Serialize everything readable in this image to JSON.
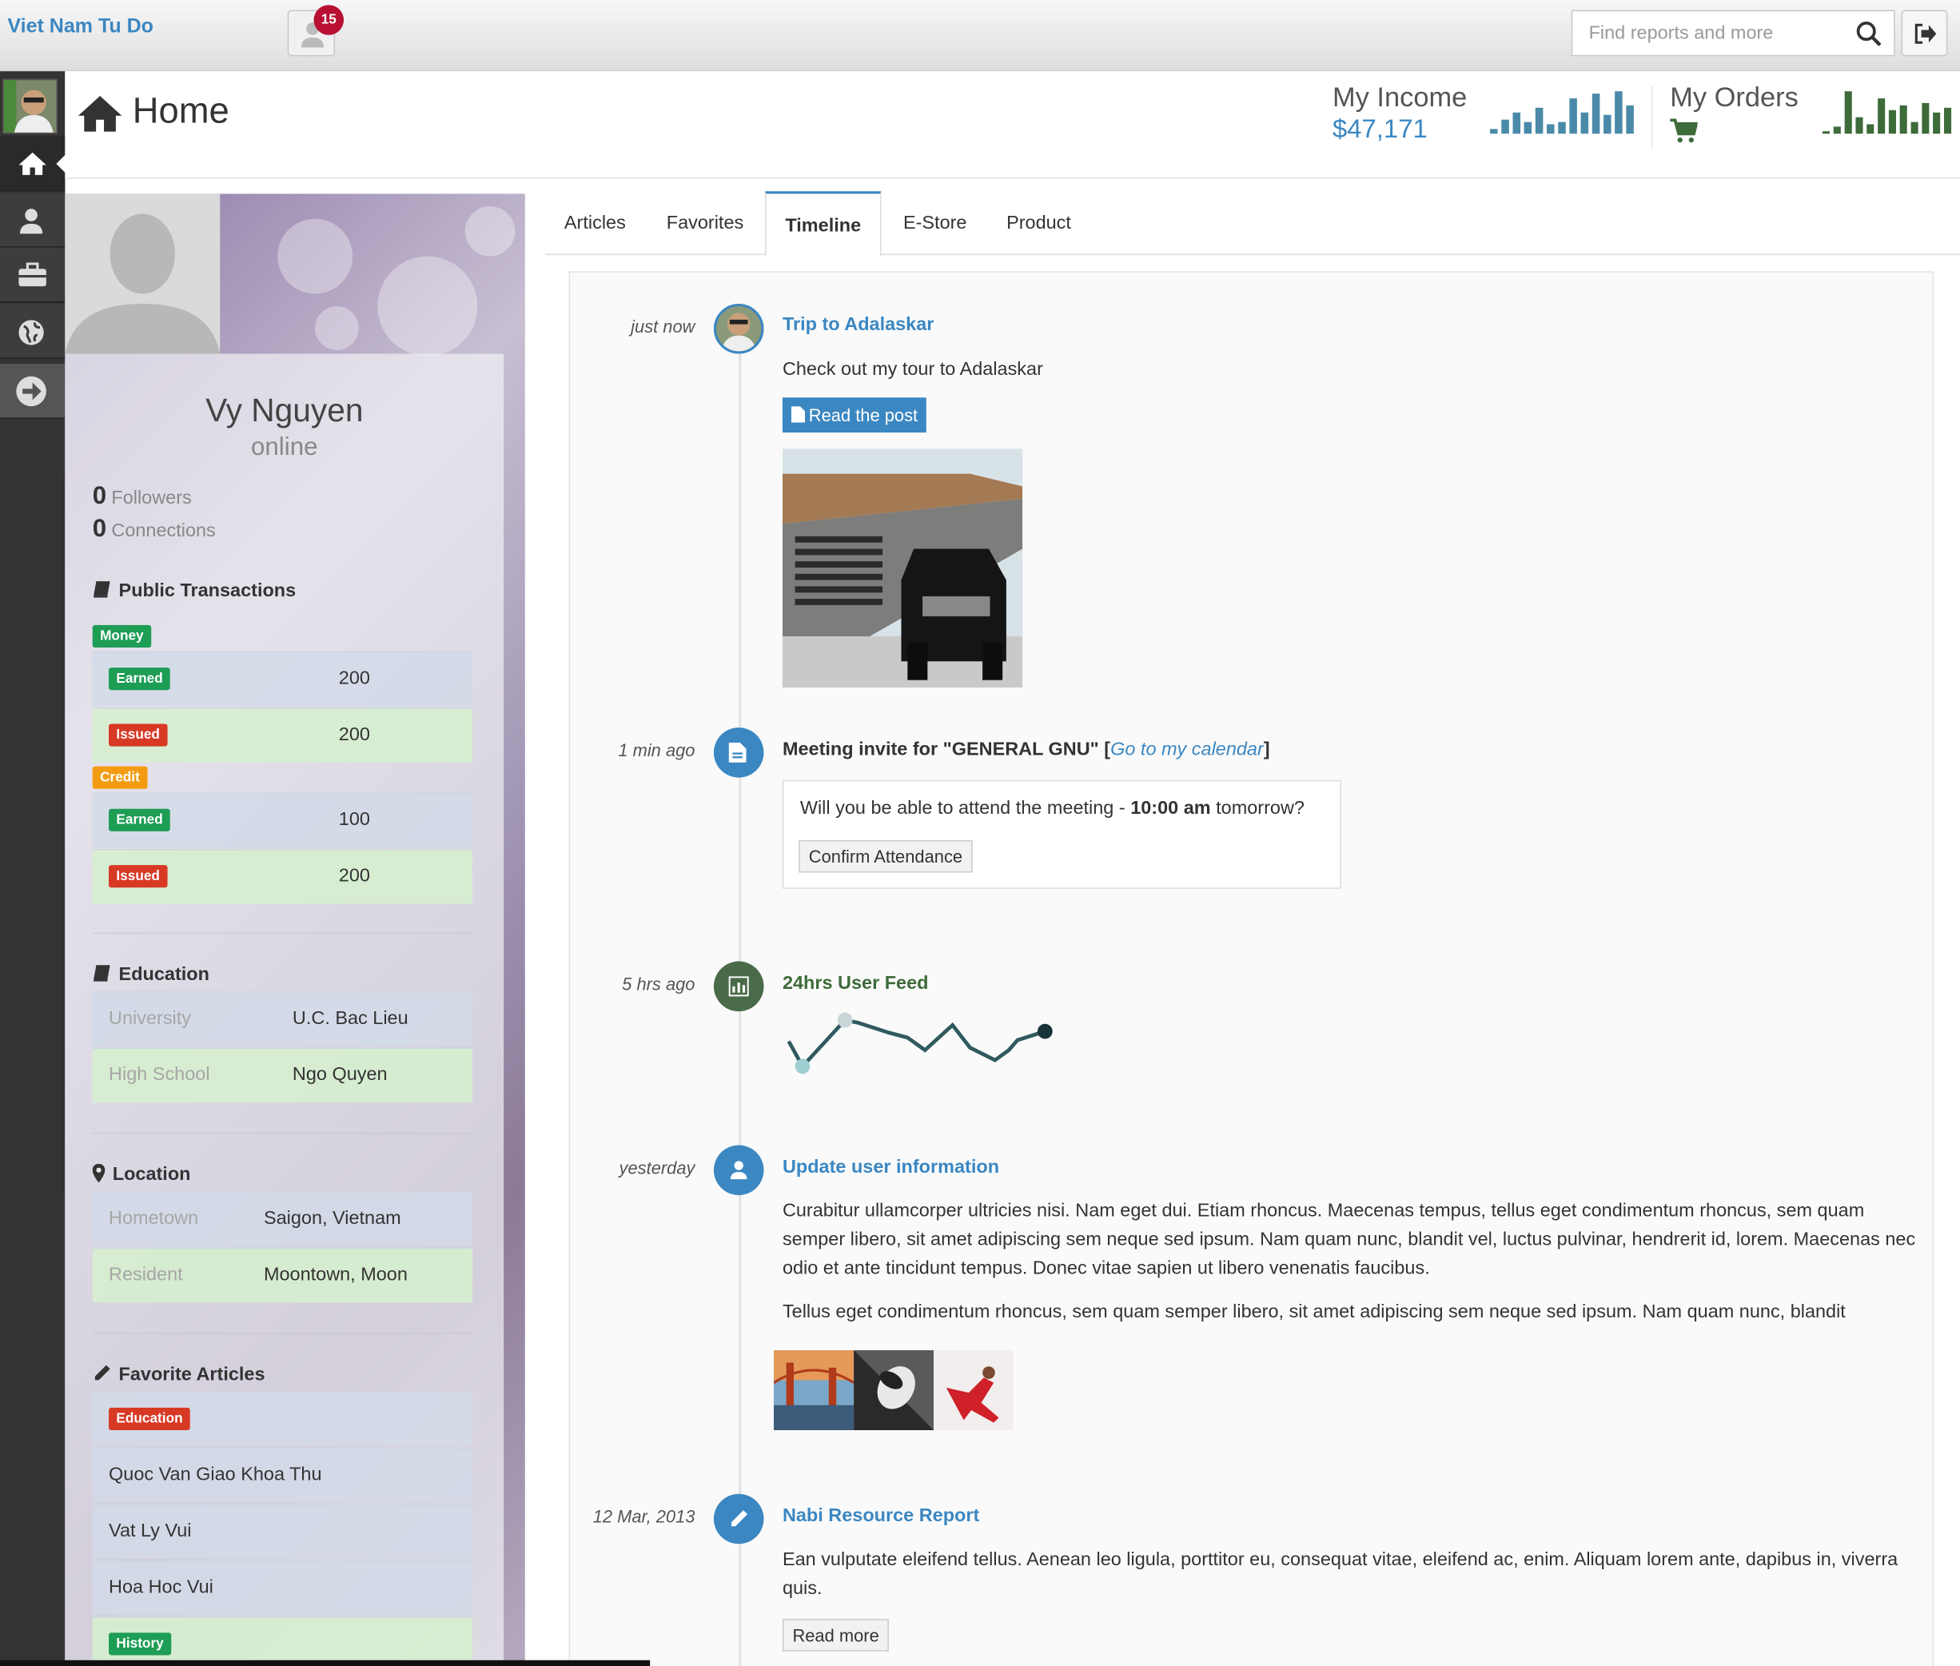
{
  "topbar": {
    "brand": "Viet Nam Tu Do",
    "notification_count": "15",
    "search_placeholder": "Find reports and more",
    "icons": {
      "notif": "user-icon",
      "search": "search-icon",
      "logout": "sign-out-icon"
    }
  },
  "sidebar": {
    "items": [
      {
        "name": "home",
        "icon": "home-icon",
        "active": true
      },
      {
        "name": "user",
        "icon": "user-icon"
      },
      {
        "name": "briefcase",
        "icon": "briefcase-icon"
      },
      {
        "name": "globe",
        "icon": "globe-icon"
      },
      {
        "name": "arrow",
        "icon": "arrow-right-circle-icon"
      }
    ]
  },
  "header": {
    "title": "Home",
    "income_label": "My Income",
    "income_value": "$47,171",
    "orders_label": "My Orders",
    "income_sparkline": [
      2,
      6,
      9,
      5,
      11,
      4,
      5,
      15,
      9,
      17,
      8,
      18,
      12
    ],
    "orders_sparkline": [
      1,
      3,
      18,
      7,
      4,
      15,
      10,
      12,
      5,
      13,
      9,
      11
    ],
    "colors": {
      "income_bars": "#4a8aa8",
      "orders_bars": "#3d6b3a"
    }
  },
  "profile": {
    "name": "Vy Nguyen",
    "status": "online",
    "followers_count": "0",
    "followers_label": "Followers",
    "connections_count": "0",
    "connections_label": "Connections",
    "transactions": {
      "title": "Public Transactions",
      "groups": [
        {
          "label": "Money",
          "color": "#1e9d55",
          "rows": [
            {
              "tag": "Earned",
              "value": "200"
            },
            {
              "tag": "Issued",
              "value": "200"
            }
          ]
        },
        {
          "label": "Credit",
          "color": "#f39c12",
          "rows": [
            {
              "tag": "Earned",
              "value": "100"
            },
            {
              "tag": "Issued",
              "value": "200"
            }
          ]
        }
      ]
    },
    "education": {
      "title": "Education",
      "rows": [
        {
          "key": "University",
          "value": "U.C. Bac Lieu"
        },
        {
          "key": "High School",
          "value": "Ngo Quyen"
        }
      ]
    },
    "location": {
      "title": "Location",
      "rows": [
        {
          "key": "Hometown",
          "value": "Saigon, Vietnam"
        },
        {
          "key": "Resident",
          "value": "Moontown, Moon"
        }
      ]
    },
    "favorite_articles": {
      "title": "Favorite Articles",
      "category_1": "Education",
      "items": [
        "Quoc Van Giao Khoa Thu",
        "Vat Ly Vui",
        "Hoa Hoc Vui"
      ],
      "category_2": "History"
    }
  },
  "tabs": [
    "Articles",
    "Favorites",
    "Timeline",
    "E-Store",
    "Product"
  ],
  "active_tab": "Timeline",
  "timeline": [
    {
      "time": "just now",
      "title": "Trip to Adalaskar",
      "text": "Check out my tour to Adalaskar",
      "button": "Read the post",
      "icon": "avatar"
    },
    {
      "time": "1 min ago",
      "title_prefix": "Meeting invite for \"GENERAL GNU\" [",
      "title_link": "Go to my calendar",
      "title_suffix": "]",
      "invite_before": "Will you be able to attend the meeting - ",
      "invite_bold": "10:00 am",
      "invite_after": " tomorrow?",
      "button": "Confirm Attendance",
      "icon": "file-icon",
      "color": "#3b87c2"
    },
    {
      "time": "5 hrs ago",
      "title": "24hrs User Feed",
      "icon": "bar-chart-icon",
      "color": "#4a6b4a"
    },
    {
      "time": "yesterday",
      "title": "Update user information",
      "text1": "Curabitur ullamcorper ultricies nisi. Nam eget dui. Etiam rhoncus. Maecenas tempus, tellus eget condimentum rhoncus, sem quam semper libero, sit amet adipiscing sem neque sed ipsum. Nam quam nunc, blandit vel, luctus pulvinar, hendrerit id, lorem. Maecenas nec odio et ante tincidunt tempus. Donec vitae sapien ut libero venenatis faucibus.",
      "text2": "Tellus eget condimentum rhoncus, sem quam semper libero, sit amet adipiscing sem neque sed ipsum. Nam quam nunc, blandit",
      "icon": "user-icon",
      "color": "#3b87c2"
    },
    {
      "time": "12 Mar, 2013",
      "title": "Nabi Resource Report",
      "text": "Ean vulputate eleifend tellus. Aenean leo ligula, porttitor eu, consequat vitae, eleifend ac, enim. Aliquam lorem ante, dapibus in, viverra quis.",
      "button": "Read more",
      "icon": "pencil-icon",
      "color": "#3b87c2"
    }
  ]
}
